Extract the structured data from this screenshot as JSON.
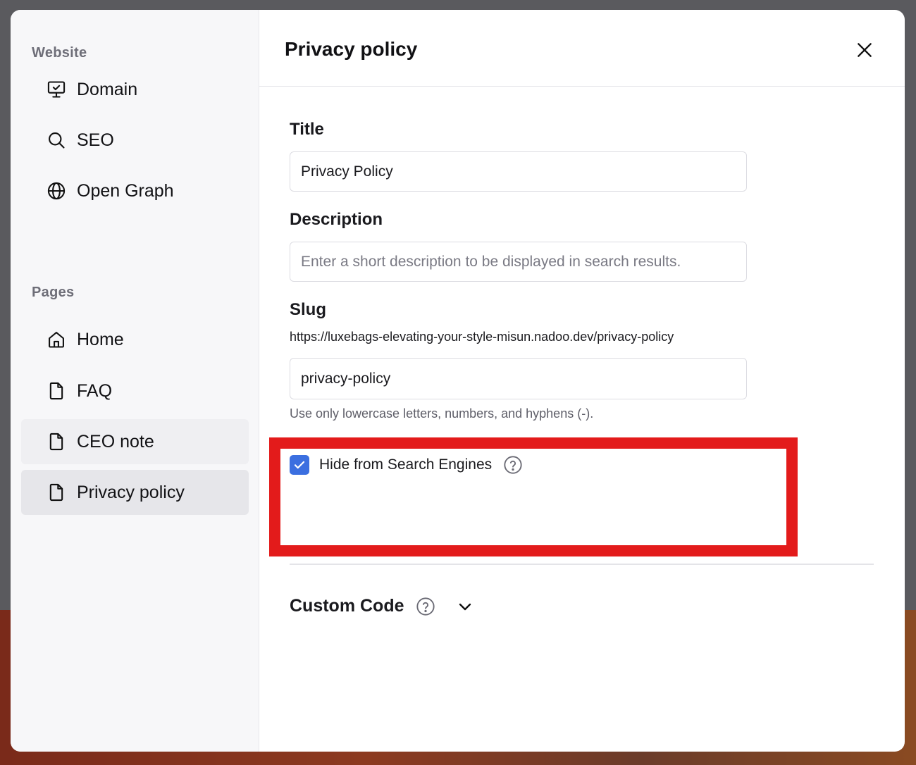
{
  "sidebar": {
    "website_label": "Website",
    "pages_label": "Pages",
    "website_items": [
      {
        "label": "Domain",
        "icon": "monitor-check-icon"
      },
      {
        "label": "SEO",
        "icon": "search-icon"
      },
      {
        "label": "Open Graph",
        "icon": "globe-icon"
      }
    ],
    "page_items": [
      {
        "label": "Home",
        "icon": "home-icon"
      },
      {
        "label": "FAQ",
        "icon": "file-icon"
      },
      {
        "label": "CEO note",
        "icon": "file-icon"
      },
      {
        "label": "Privacy policy",
        "icon": "file-icon",
        "active": true
      }
    ]
  },
  "header": {
    "title": "Privacy policy"
  },
  "form": {
    "title_label": "Title",
    "title_value": "Privacy Policy",
    "description_label": "Description",
    "description_placeholder": "Enter a short description to be displayed in search results.",
    "slug_label": "Slug",
    "slug_url": "https://luxebags-elevating-your-style-misun.nadoo.dev/privacy-policy",
    "slug_value": "privacy-policy",
    "slug_helper": "Use only lowercase letters, numbers, and hyphens (-).",
    "hide_label": "Hide from Search Engines",
    "hide_checked": true,
    "custom_code_label": "Custom Code"
  },
  "colors": {
    "accent": "#3b6fe0",
    "highlight": "#e31b1b"
  }
}
